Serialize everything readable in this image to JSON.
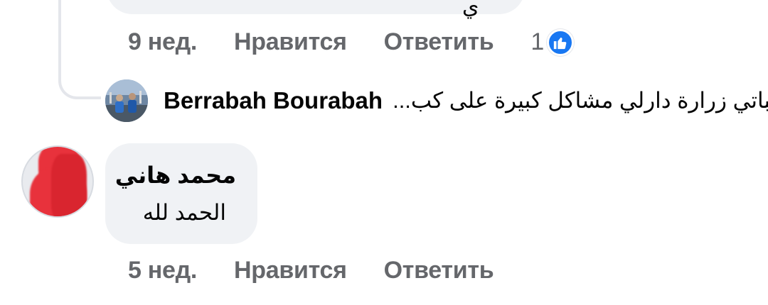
{
  "top_comment": {
    "text_fragment": "ي",
    "actions": {
      "time": "9 нед.",
      "like_label": "Нравится",
      "reply_label": "Ответить",
      "reaction_count": "1",
      "reaction_icon": "thumbs-up-icon"
    }
  },
  "reply_preview": {
    "author": "Berrabah Bourabah",
    "text": "كباتي زرارة دارلي مشاكل كبيرة على كب..."
  },
  "comment": {
    "author": "محمد هاني",
    "text": "الحمد لله",
    "actions": {
      "time": "5 нед.",
      "like_label": "Нравится",
      "reply_label": "Ответить"
    }
  },
  "colors": {
    "bubble_bg": "#f0f2f5",
    "meta_text": "#65676b",
    "like_blue": "#1877f2",
    "thread_line": "#e4e6eb",
    "redaction_red": "#e8323c"
  }
}
